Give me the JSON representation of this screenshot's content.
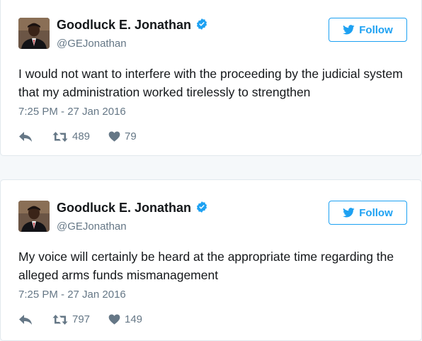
{
  "colors": {
    "accent": "#1da1f2",
    "text": "#14171a",
    "secondary": "#657786",
    "border": "#e1e8ed"
  },
  "tweets": [
    {
      "author": {
        "name": "Goodluck E. Jonathan",
        "handle": "@GEJonathan",
        "verified": true,
        "avatar_icon": "profile-photo"
      },
      "follow_label": "Follow",
      "text": "I would not want to interfere with the proceeding by the judicial system that my administration worked tirelessly to strengthen",
      "timestamp": "7:25 PM - 27 Jan 2016",
      "retweets": "489",
      "likes": "79"
    },
    {
      "author": {
        "name": "Goodluck E. Jonathan",
        "handle": "@GEJonathan",
        "verified": true,
        "avatar_icon": "profile-photo"
      },
      "follow_label": "Follow",
      "text": "My voice will certainly be heard at the appropriate time regarding the alleged arms funds mismanagement",
      "timestamp": "7:25 PM - 27 Jan 2016",
      "retweets": "797",
      "likes": "149"
    }
  ]
}
